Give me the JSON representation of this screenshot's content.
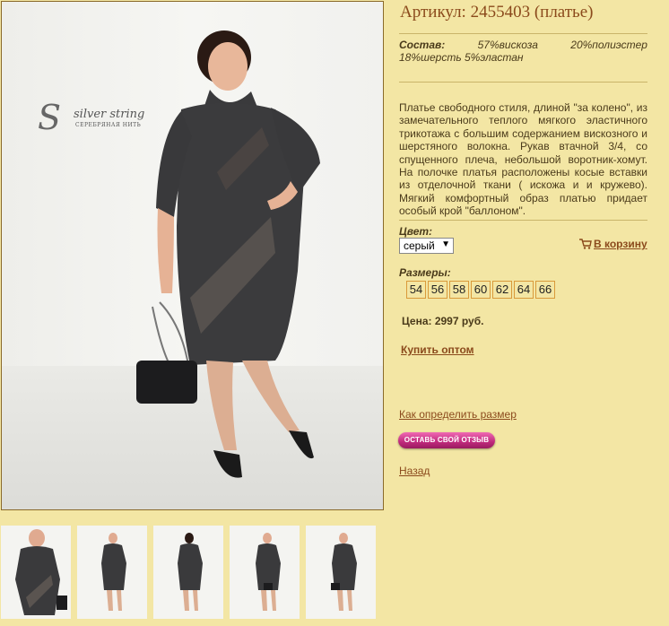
{
  "product": {
    "title": "Артикул: 2455403 (платье)",
    "composition_label": "Состав:",
    "composition_parts": [
      "57%вискоза",
      "20%полиэстер"
    ],
    "composition_line2": "18%шерсть 5%эластан",
    "description": "Платье свободного стиля, длиной \"за колено\", из замечательного теплого мягкого эластичного трикотажа с большим содержанием вискозного и шерстяного волокна. Рукав втачной 3/4, со спущенного плеча, небольшой воротник-хомут. На полочке платья расположены косые вставки из отделочной ткани ( искожа и и кружево). Мягкий комфортный образ платью придает особый крой \"баллоном\".",
    "color_label": "Цвет:",
    "color_selected": "серый",
    "cart_label": "В корзину",
    "sizes_label": "Размеры:",
    "sizes": [
      "54",
      "56",
      "58",
      "60",
      "62",
      "64",
      "66"
    ],
    "price": "Цена: 2997 руб.",
    "wholesale_link": "Купить оптом",
    "size_guide_link": "Как определить размер",
    "review_button": "ОСТАВЬ СВОЙ ОТЗЫВ",
    "back_link": "Назад"
  },
  "brand": {
    "initial": "S",
    "name": "silver string",
    "subtitle": "СЕРЕБРЯНАЯ НИТЬ"
  },
  "icons": {
    "cart": "shopping-cart-icon"
  },
  "colors": {
    "background": "#f3e6a4",
    "link": "#8b4a1c",
    "size_border": "#d99a3a",
    "button_pink": "#c02a7c"
  }
}
